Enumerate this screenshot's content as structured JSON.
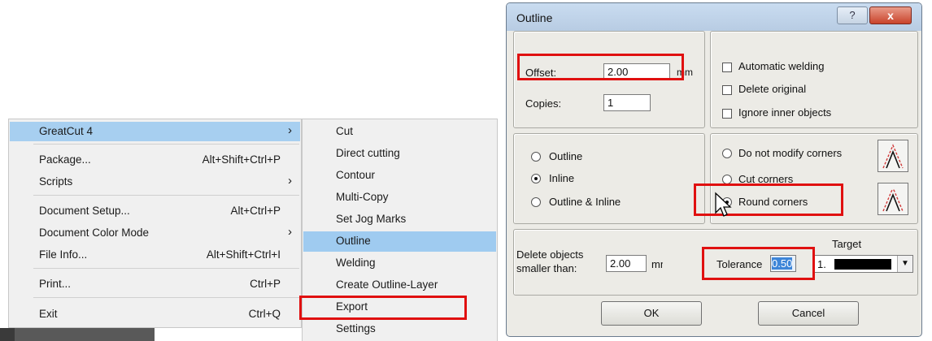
{
  "file_menu": {
    "items": [
      {
        "label": "GreatCut 4",
        "shortcut": "",
        "submenu": true
      },
      {
        "label": "Package...",
        "shortcut": "Alt+Shift+Ctrl+P",
        "submenu": false
      },
      {
        "label": "Scripts",
        "shortcut": "",
        "submenu": true
      },
      {
        "label": "Document Setup...",
        "shortcut": "Alt+Ctrl+P",
        "submenu": false
      },
      {
        "label": "Document Color Mode",
        "shortcut": "",
        "submenu": true
      },
      {
        "label": "File Info...",
        "shortcut": "Alt+Shift+Ctrl+I",
        "submenu": false
      },
      {
        "label": "Print...",
        "shortcut": "Ctrl+P",
        "submenu": false
      },
      {
        "label": "Exit",
        "shortcut": "Ctrl+Q",
        "submenu": false
      }
    ],
    "highlighted": "GreatCut 4",
    "submenu_arrow": "›"
  },
  "greatcut_submenu": {
    "items": [
      "Cut",
      "Direct cutting",
      "Contour",
      "Multi-Copy",
      "Set Jog Marks",
      "Outline",
      "Welding",
      "Create Outline-Layer",
      "Export",
      "Settings"
    ],
    "highlighted": "Outline",
    "annotated": "Export"
  },
  "dialog": {
    "title": "Outline",
    "help_button": "?",
    "close_button": "x",
    "offset_label": "Offset:",
    "offset_value": "2.00",
    "offset_unit": "mm",
    "copies_label": "Copies:",
    "copies_value": "1",
    "checkboxes": [
      {
        "label": "Automatic welding",
        "checked": false
      },
      {
        "label": "Delete original",
        "checked": false
      },
      {
        "label": "Ignore inner objects",
        "checked": false
      }
    ],
    "mode_options": [
      {
        "label": "Outline",
        "selected": false
      },
      {
        "label": "Inline",
        "selected": true
      },
      {
        "label": "Outline & Inline",
        "selected": false
      }
    ],
    "corner_options": [
      {
        "label": "Do not modify corners",
        "selected": false
      },
      {
        "label": "Cut corners",
        "selected": false
      },
      {
        "label": "Round corners",
        "selected": true
      }
    ],
    "delete_label_line1": "Delete objects",
    "delete_label_line2": "smaller than:",
    "delete_value": "2.00",
    "delete_unit": "mm",
    "tolerance_label": "Tolerance",
    "tolerance_value": "0.50",
    "target_label": "Target",
    "target_value": "1.",
    "target_color": "#000000",
    "ok_button": "OK",
    "cancel_button": "Cancel"
  },
  "colors": {
    "annotation_red": "#e01010",
    "menu_highlight": "#a7cff0",
    "dialog_face": "#ecebe6"
  }
}
